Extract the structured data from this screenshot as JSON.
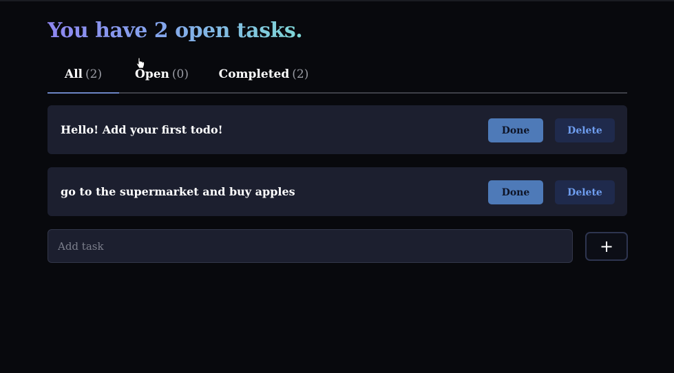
{
  "header": {
    "title": "You have 2 open tasks."
  },
  "tabs": [
    {
      "label": "All",
      "count": "(2)",
      "active": true
    },
    {
      "label": "Open",
      "count": "(0)",
      "active": false
    },
    {
      "label": "Completed",
      "count": "(2)",
      "active": false
    }
  ],
  "tasks": [
    {
      "text": "Hello! Add your first todo!",
      "done_label": "Done",
      "delete_label": "Delete"
    },
    {
      "text": "go to the supermarket and buy apples",
      "done_label": "Done",
      "delete_label": "Delete"
    }
  ],
  "add_task": {
    "placeholder": "Add task",
    "value": "",
    "button_label": "+"
  },
  "colors": {
    "background": "#08090d",
    "card": "#1c1f2f",
    "done_button": "#4e7ab8",
    "delete_button": "#1f2a4c",
    "delete_text": "#6f9ef0",
    "active_tab_underline": "#6d86c6",
    "title_gradient": [
      "#8e86f0",
      "#7fd8d6"
    ]
  }
}
